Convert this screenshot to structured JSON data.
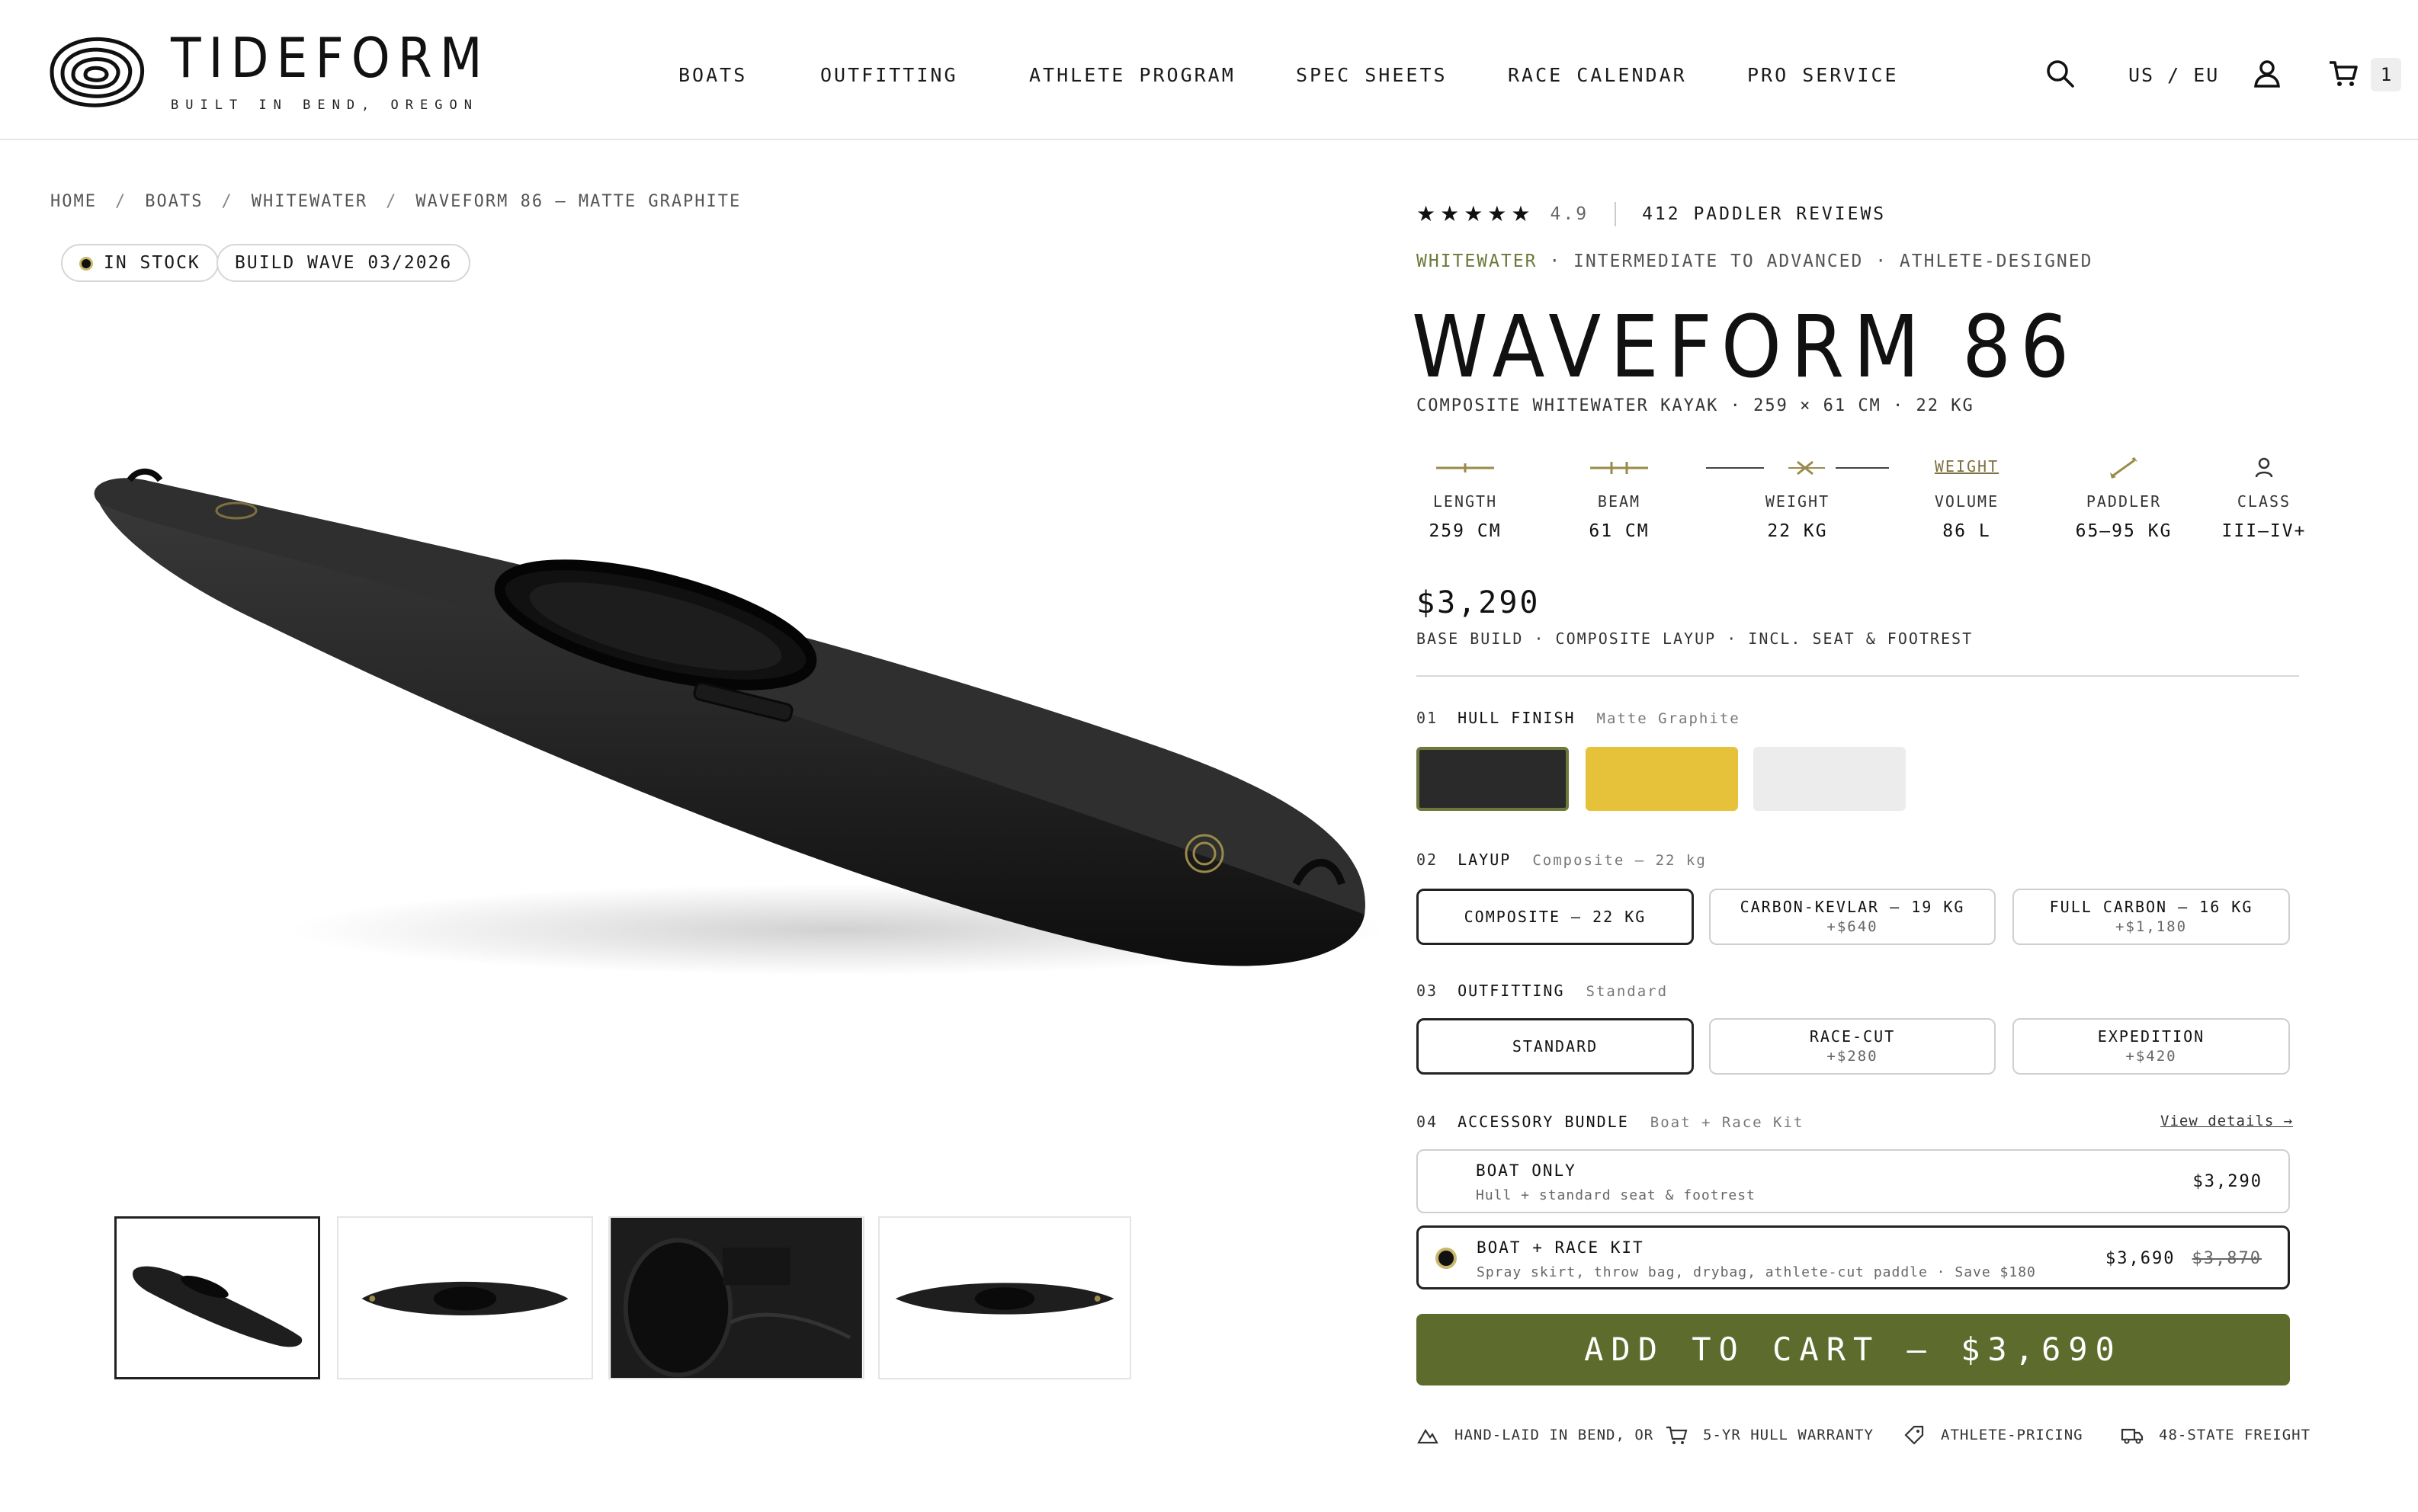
{
  "brand": {
    "name": "TIDEFORM",
    "tagline": "BUILT IN BEND, OREGON"
  },
  "nav": [
    "BOATS",
    "OUTFITTING",
    "ATHLETE PROGRAM",
    "SPEC SHEETS",
    "RACE CALENDAR",
    "PRO SERVICE"
  ],
  "utility": {
    "region": "US / EU",
    "cart_count": "1",
    "icons": [
      "search-icon",
      "account-icon",
      "cart-icon"
    ]
  },
  "breadcrumb": [
    "HOME",
    "BOATS",
    "WHITEWATER",
    "WAVEFORM 86 — MATTE GRAPHITE"
  ],
  "badges": {
    "stock": "IN STOCK",
    "build_wave": "BUILD WAVE  03/2026"
  },
  "product": {
    "stars": "★★★★★",
    "rating": "4.9",
    "reviews": "412 PADDLER REVIEWS",
    "category": "WHITEWATER",
    "tagline_rest": " · INTERMEDIATE TO ADVANCED · ATHLETE-DESIGNED",
    "title": "WAVEFORM 86",
    "subtitle": "COMPOSITE WHITEWATER KAYAK  ·  259 × 61 CM  ·  22 KG",
    "price": "$3,290",
    "price_note": "BASE BUILD  ·  COMPOSITE LAYUP  ·  INCL. SEAT & FOOTREST"
  },
  "specs": [
    {
      "label": "LENGTH",
      "value": "259 CM"
    },
    {
      "label": "BEAM",
      "value": "61 CM"
    },
    {
      "label": "WEIGHT",
      "value": "22 KG"
    },
    {
      "label": "VOLUME",
      "value": "86 L"
    },
    {
      "label": "PADDLER",
      "value": "65–95 KG"
    },
    {
      "label": "CLASS",
      "value": "III–IV+"
    }
  ],
  "spec_extra_label": "WEIGHT",
  "options": {
    "hull": {
      "num": "01",
      "name": "HULL FINISH",
      "selected": "Matte Graphite",
      "swatches": [
        "#2a2a2a",
        "#e6c13a",
        "#ececec"
      ]
    },
    "layup": {
      "num": "02",
      "name": "LAYUP",
      "selected": "Composite — 22 kg",
      "choices": [
        {
          "label": "COMPOSITE — 22 KG",
          "add": ""
        },
        {
          "label": "CARBON-KEVLAR — 19 KG",
          "add": "+$640"
        },
        {
          "label": "FULL CARBON — 16 KG",
          "add": "+$1,180"
        }
      ]
    },
    "outfitting": {
      "num": "03",
      "name": "OUTFITTING",
      "selected": "Standard",
      "choices": [
        {
          "label": "STANDARD",
          "add": ""
        },
        {
          "label": "RACE-CUT",
          "add": "+$280"
        },
        {
          "label": "EXPEDITION",
          "add": "+$420"
        }
      ]
    },
    "bundle": {
      "num": "04",
      "name": "ACCESSORY BUNDLE",
      "selected": "Boat + Race Kit",
      "view_details": "View details →",
      "choices": [
        {
          "name": "BOAT ONLY",
          "desc": "Hull + standard seat & footrest",
          "price": "$3,290",
          "was": ""
        },
        {
          "name": "BOAT + RACE KIT",
          "desc": "Spray skirt, throw bag, drybag, athlete-cut paddle · Save $180",
          "price": "$3,690",
          "was": "$3,870"
        }
      ]
    }
  },
  "cta": "ADD TO CART  —  $3,690",
  "assurances": [
    "HAND-LAID IN BEND, OR",
    "5-YR HULL WARRANTY",
    "ATHLETE-PRICING",
    "48-STATE FREIGHT"
  ],
  "colors": {
    "accent": "#5d6b2c",
    "gold": "#c9b76a",
    "ink": "#111111"
  }
}
